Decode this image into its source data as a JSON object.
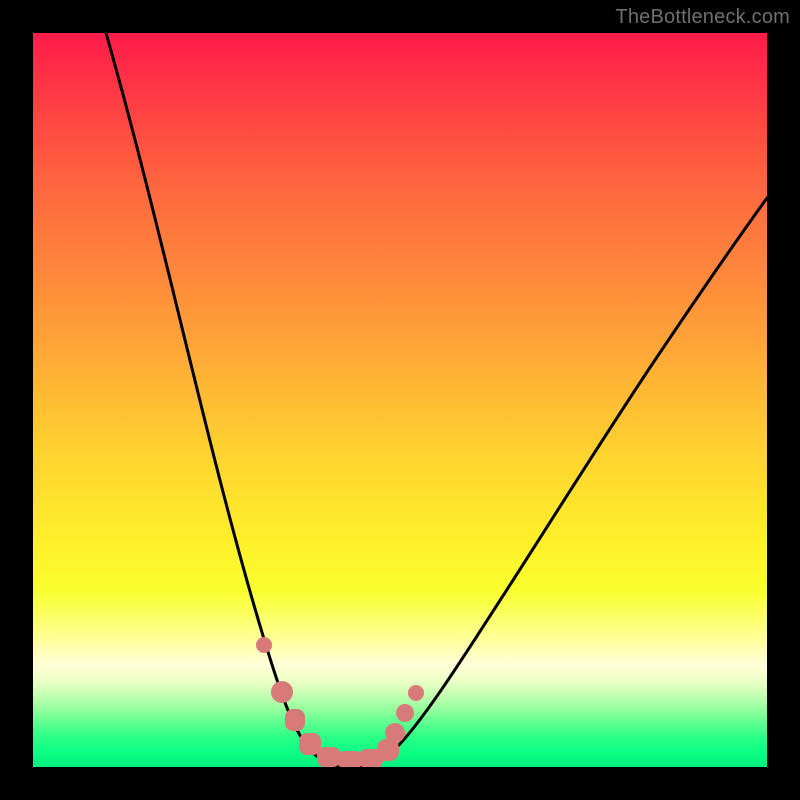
{
  "watermark": "TheBottleneck.com",
  "colors": {
    "background": "#000000",
    "watermark": "#6f6f6f",
    "curve": "#000000",
    "markers": "#d87a7a",
    "gradient_top": "#ff1b4a",
    "gradient_bottom": "#00ef7d"
  },
  "chart_data": {
    "type": "line",
    "title": "",
    "xlabel": "",
    "ylabel": "",
    "xlim": [
      0,
      100
    ],
    "ylim": [
      0,
      100
    ],
    "grid": false,
    "legend": false,
    "series": [
      {
        "name": "bottleneck-curve",
        "x": [
          10,
          15,
          20,
          25,
          28,
          30,
          32,
          34,
          35,
          36,
          37,
          38,
          39,
          40,
          42,
          45,
          50,
          55,
          60,
          65,
          70,
          75,
          80,
          85,
          90,
          95,
          100
        ],
        "values": [
          100,
          78,
          58,
          40,
          30,
          24,
          18,
          12,
          9,
          6,
          4,
          2,
          1,
          0,
          0,
          0,
          3,
          8,
          14,
          21,
          28,
          35,
          42,
          49,
          56,
          62,
          68
        ]
      }
    ],
    "marker_series": {
      "name": "highlighted-points",
      "x": [
        31.5,
        34.2,
        36.2,
        38.2,
        40.0,
        42.0,
        44.0,
        46.0,
        48.0,
        49.5,
        51.0
      ],
      "values": [
        18,
        10,
        5,
        2,
        0,
        0,
        0,
        1,
        3,
        6,
        9
      ]
    }
  }
}
